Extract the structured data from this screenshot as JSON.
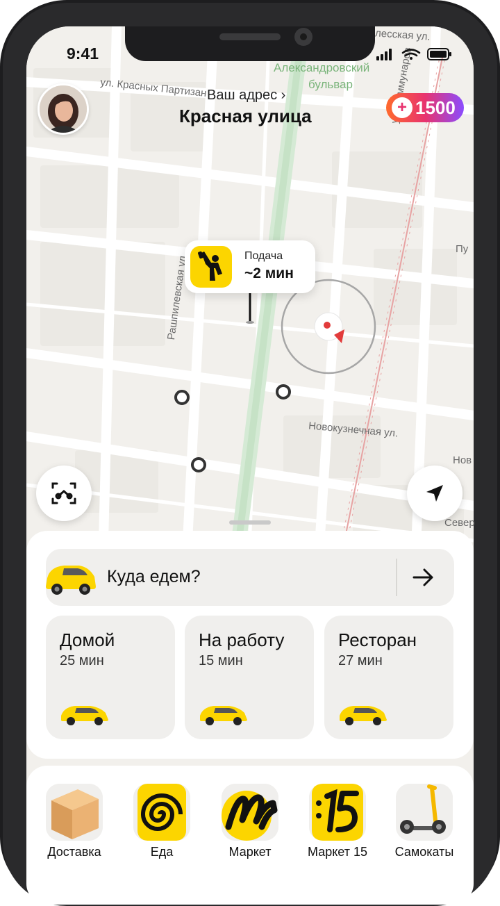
{
  "status_bar": {
    "time": "9:41"
  },
  "header": {
    "address_label": "Ваш адрес",
    "address_chevron": "›",
    "address_title": "Красная улица",
    "plus_points": "1500",
    "plus_symbol": "+"
  },
  "map": {
    "labels": {
      "boulevard_line1": "Александровский",
      "boulevard_line2": "бульвар",
      "krasnyh_partizan": "ул. Красных Партизан",
      "kommunarov": "ул. Коммунаров",
      "rashpilevskaya": "Рашпилевская ул.",
      "novokuznechnaya": "Новокузнечная ул.",
      "top_right": "лесская ул.",
      "right_mid": "Пу",
      "right_nov": "Нов",
      "right_sev": "Север"
    }
  },
  "pickup": {
    "label": "Подача",
    "eta": "~2 мин"
  },
  "sheet": {
    "where_placeholder": "Куда едем?",
    "shortcuts": [
      {
        "title": "Домой",
        "time": "25 мин"
      },
      {
        "title": "На работу",
        "time": "15 мин"
      },
      {
        "title": "Ресторан",
        "time": "27 мин"
      }
    ]
  },
  "services": [
    {
      "label": "Доставка",
      "icon": "box-icon"
    },
    {
      "label": "Еда",
      "icon": "food-spiral-icon"
    },
    {
      "label": "Маркет",
      "icon": "market-icon"
    },
    {
      "label": "Маркет 15",
      "icon": "market-15-icon"
    },
    {
      "label": "Самокаты",
      "icon": "scooter-icon"
    }
  ],
  "colors": {
    "brand_yellow": "#fcd500",
    "map_background": "#f2f0ec",
    "route_red": "#e23b3b",
    "plus_gradient_start": "#ff6a2d",
    "plus_gradient_end": "#8b4dff"
  }
}
